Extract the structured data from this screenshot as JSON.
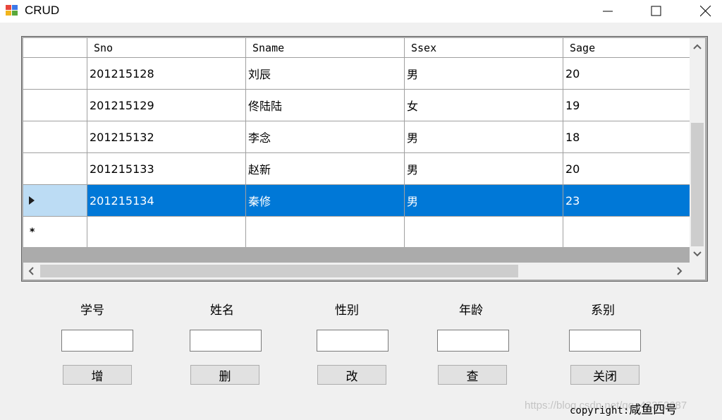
{
  "window": {
    "title": "CRUD"
  },
  "grid": {
    "columns": [
      "Sno",
      "Sname",
      "Ssex",
      "Sage"
    ],
    "rows": [
      [
        "201215128",
        "刘辰",
        "男",
        "20"
      ],
      [
        "201215129",
        "佟陆陆",
        "女",
        "19"
      ],
      [
        "201215132",
        "李念",
        "男",
        "18"
      ],
      [
        "201215133",
        "赵新",
        "男",
        "20"
      ],
      [
        "201215134",
        "秦修",
        "男",
        "23"
      ]
    ],
    "selected_row": 4,
    "new_row_marker": "*"
  },
  "form": {
    "labels": {
      "sno": "学号",
      "sname": "姓名",
      "ssex": "性别",
      "sage": "年龄",
      "sdept": "系别"
    },
    "values": {
      "sno": "",
      "sname": "",
      "ssex": "",
      "sage": "",
      "sdept": ""
    }
  },
  "buttons": {
    "add": "增",
    "delete": "删",
    "update": "改",
    "query": "查",
    "close": "关闭"
  },
  "footer": {
    "copyright_prefix": "copyright:",
    "copyright_name": "咸鱼四号"
  },
  "watermark": "https://blog.csdn.net/qq_43352687",
  "colors": {
    "selection": "#0078d7",
    "row_header_selected": "#bcdcf4"
  },
  "icons": [
    "app-icon",
    "minimize-icon",
    "maximize-icon",
    "close-icon",
    "row-pointer-icon",
    "scroll-up-icon",
    "scroll-down-icon",
    "scroll-left-icon",
    "scroll-right-icon"
  ]
}
